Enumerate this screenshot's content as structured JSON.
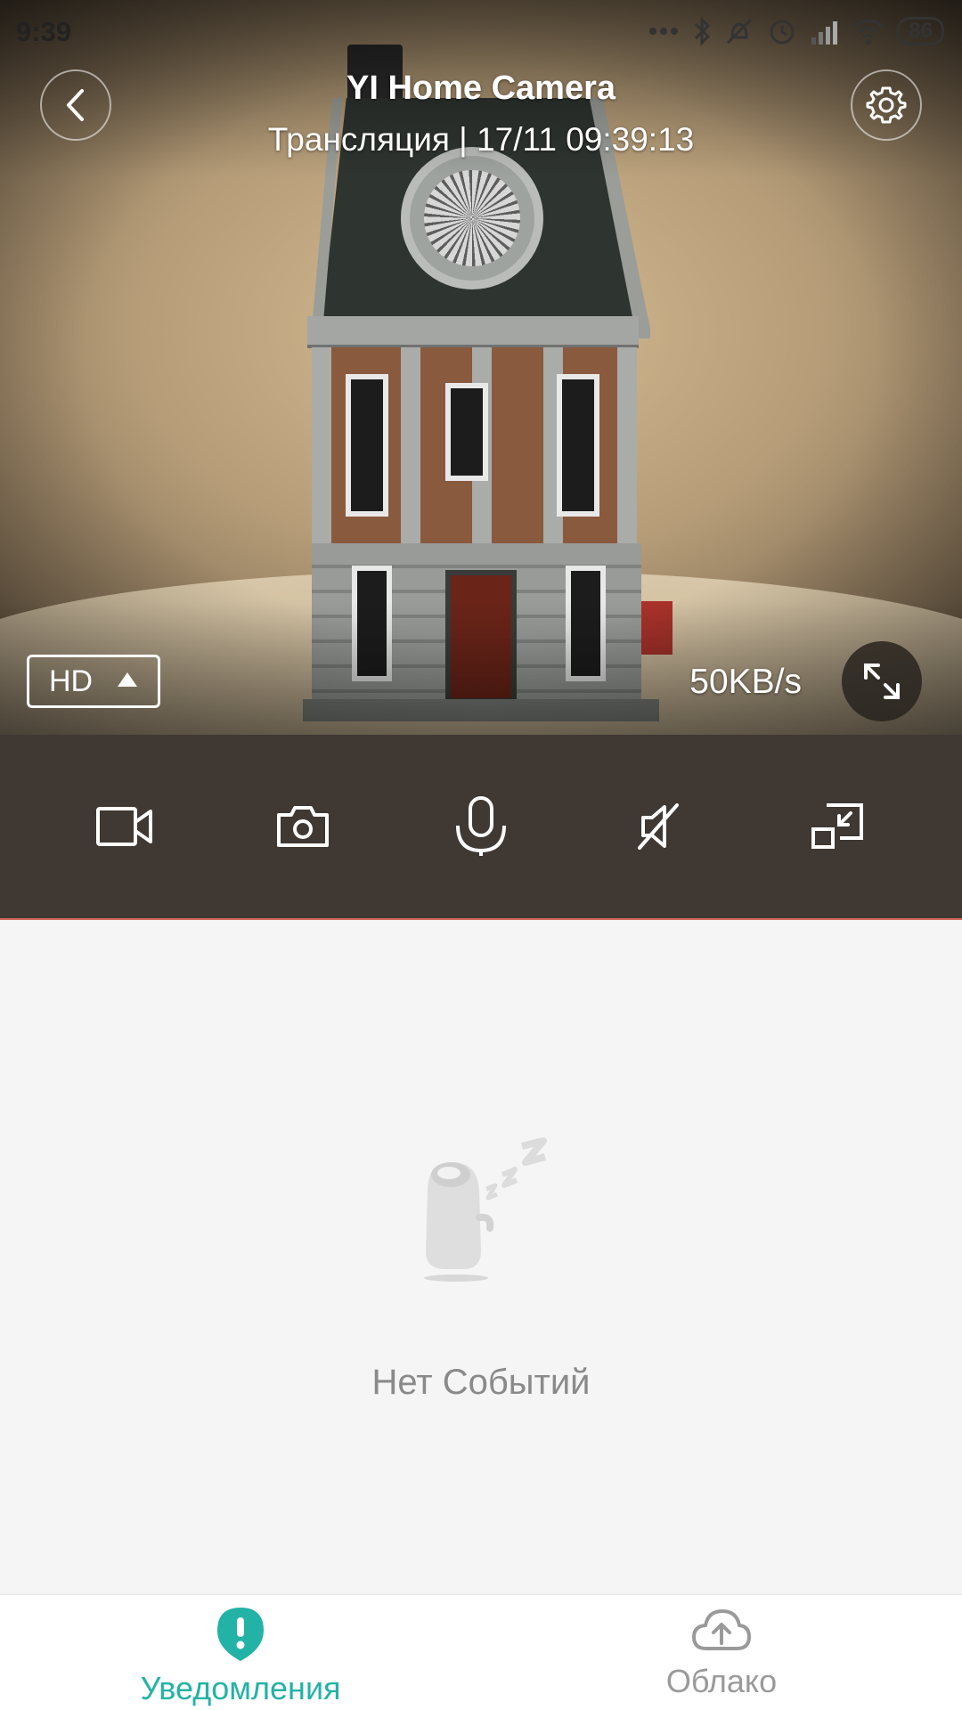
{
  "status_bar": {
    "time": "9:39",
    "battery": "86"
  },
  "header": {
    "title": "YI Home Camera",
    "subtitle": "Трансляция | 17/11 09:39:13"
  },
  "video": {
    "quality_label": "HD",
    "speed": "50KB/s"
  },
  "controls": [
    {
      "name": "record-video",
      "icon": "video-camera-icon"
    },
    {
      "name": "snapshot",
      "icon": "photo-camera-icon"
    },
    {
      "name": "talk",
      "icon": "microphone-icon"
    },
    {
      "name": "mute",
      "icon": "speaker-muted-icon"
    },
    {
      "name": "minimize",
      "icon": "picture-in-picture-icon"
    }
  ],
  "events": {
    "empty_text": "Нет Событий"
  },
  "bottom_nav": {
    "items": [
      {
        "label": "Уведомления",
        "icon": "alert-icon",
        "active": true
      },
      {
        "label": "Облако",
        "icon": "cloud-upload-icon",
        "active": false
      }
    ]
  },
  "colors": {
    "accent": "#23b2a6",
    "control_bar": "#3f3833",
    "inactive": "#9a9a9a"
  }
}
